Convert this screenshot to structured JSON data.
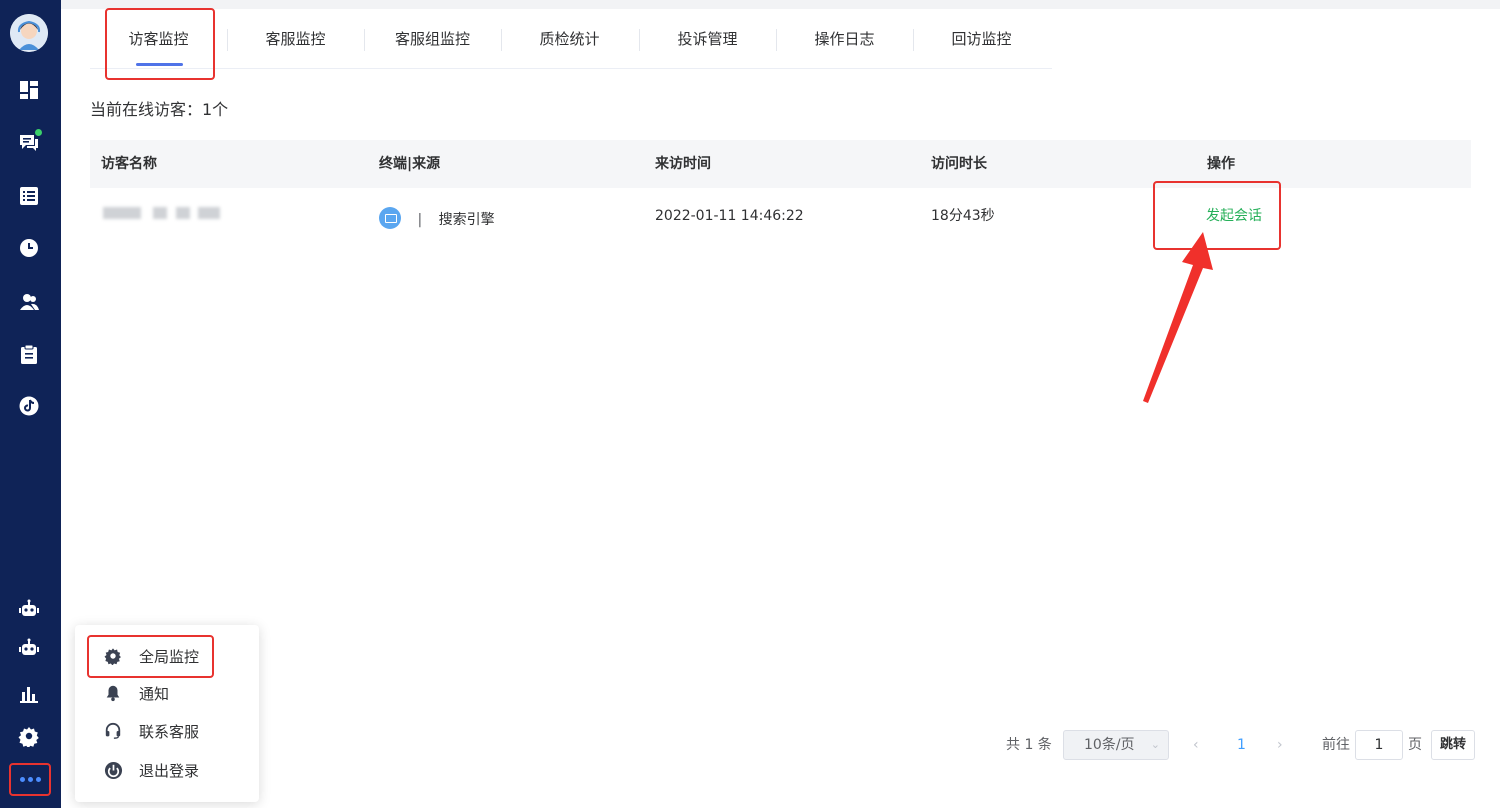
{
  "tabs": [
    {
      "label": "访客监控"
    },
    {
      "label": "客服监控"
    },
    {
      "label": "客服组监控"
    },
    {
      "label": "质检统计"
    },
    {
      "label": "投诉管理"
    },
    {
      "label": "操作日志"
    },
    {
      "label": "回访监控"
    }
  ],
  "online_text": "当前在线访客：1个",
  "table": {
    "headers": [
      "访客名称",
      "终端|来源",
      "来访时间",
      "访问时长",
      "操作"
    ],
    "rows": [
      {
        "name": "",
        "source_sep": "|",
        "source": "搜索引擎",
        "visit_time": "2022-01-11 14:46:22",
        "duration": "18分43秒",
        "action": "发起会话"
      }
    ]
  },
  "popup_menu": [
    {
      "label": "全局监控",
      "icon": "gear-icon"
    },
    {
      "label": "通知",
      "icon": "bell-icon"
    },
    {
      "label": "联系客服",
      "icon": "headset-icon"
    },
    {
      "label": "退出登录",
      "icon": "power-icon"
    }
  ],
  "pagination": {
    "total": "共 1 条",
    "page_size": "10条/页",
    "current_page": "1",
    "goto_label": "前往",
    "goto_value": "1",
    "page_label": "页",
    "jump_label": "跳转"
  },
  "colors": {
    "sidebar": "#0f2357",
    "accent": "#4f73e8",
    "action_green": "#27b05a",
    "highlight_red": "#e8332f"
  }
}
